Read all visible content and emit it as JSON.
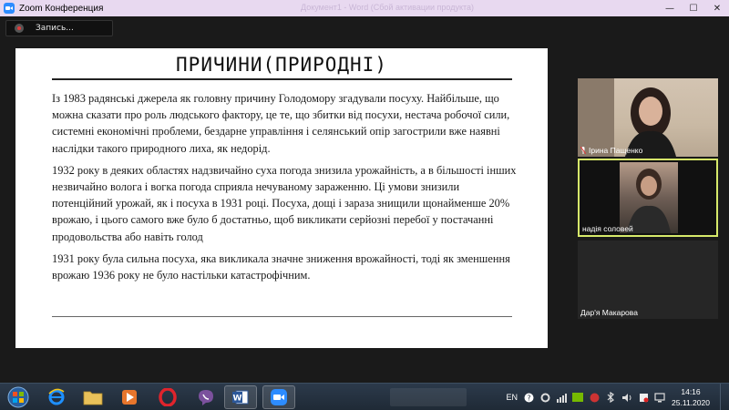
{
  "window": {
    "title": "Zoom Конференция",
    "ghost_title": "Документ1 - Word (Сбой активации продукта)",
    "controls": {
      "minimize": "—",
      "maximize": "☐",
      "close": "✕"
    }
  },
  "recording": {
    "label": "Запись..."
  },
  "slide": {
    "title": "ПРИЧИНИ(ПРИРОДНІ)",
    "paragraphs": [
      "Із 1983 радянські джерела як головну причину Голодомору згадували посуху. Найбільше, що можна сказати про роль людського фактору, це те, що збитки від посухи, нестача робочої сили, системні економічні проблеми, бездарне управління і селянський опір загострили вже наявні наслідки такого природного лиха, як недорід.",
      "1932 року в деяких областях надзвичайно суха погода знизила урожайність, а в більшості інших незвичайно волога і вогка погода сприяла нечуваному зараженню. Ці умови знизили потенційний урожай, як і посуха в 1931 році. Посуха, дощі і зараза знищили щонайменше 20% врожаю, і цього самого вже було б достатньо, щоб викликати серйозні перебої у постачанні продовольства або навіть голод",
      "1931 року була сильна посуха, яка викликала значне зниження врожайності, тоді як зменшення врожаю 1936 року не було настільки катастрофічним."
    ]
  },
  "participants": [
    {
      "name": "Ірина Пащенко",
      "muted": true
    },
    {
      "name": "надія соловей",
      "muted": false,
      "active_speaker": true
    },
    {
      "name": "Дар'я Макарова",
      "muted": false
    }
  ],
  "taskbar": {
    "apps": [
      {
        "icon": "start-orb-icon"
      },
      {
        "icon": "internet-explorer-icon"
      },
      {
        "icon": "file-explorer-icon"
      },
      {
        "icon": "media-player-icon"
      },
      {
        "icon": "opera-icon"
      },
      {
        "icon": "viber-icon"
      },
      {
        "icon": "word-icon"
      },
      {
        "icon": "zoom-icon"
      }
    ],
    "language": "EN",
    "time": "14:16",
    "date": "25.11.2020"
  },
  "colors": {
    "titlebar_bg": "#e8d9f0",
    "active_speaker_border": "#d6e96a",
    "zoom_blue": "#2d8cff"
  }
}
